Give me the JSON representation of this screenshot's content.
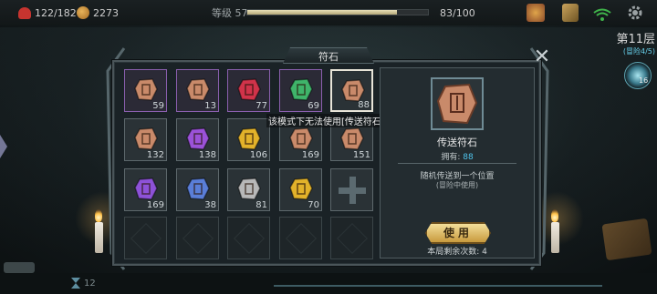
{
  "hud": {
    "hp": "122/182",
    "gold": "2273",
    "level_label": "等级 57",
    "xp_text": "83/100",
    "xp_fraction": 0.83,
    "icons": [
      "chest-icon",
      "map-card-icon",
      "wifi-icon",
      "gear-icon"
    ]
  },
  "floor": {
    "title": "第11层",
    "subtitle": "(冒险4/5)",
    "orb_count": "16"
  },
  "panel": {
    "title": "符石",
    "close_icon": "close-icon",
    "tooltip": "该模式下无法使用[传送符石]"
  },
  "runes": [
    {
      "name": "rune-1",
      "count": "59",
      "color": "#c98a6a",
      "rarity": "purple"
    },
    {
      "name": "rune-2",
      "count": "13",
      "color": "#c98a6a",
      "rarity": "purple"
    },
    {
      "name": "rune-3",
      "count": "77",
      "color": "#d0334a",
      "rarity": "purple"
    },
    {
      "name": "rune-4",
      "count": "69",
      "color": "#3fb46a",
      "rarity": "purple"
    },
    {
      "name": "teleport-rune",
      "count": "88",
      "color": "#c98a6a",
      "rarity": "selected"
    },
    {
      "name": "rune-6",
      "count": "132",
      "color": "#c98a6a",
      "rarity": "normal"
    },
    {
      "name": "rune-7",
      "count": "138",
      "color": "#9b52d8",
      "rarity": "normal"
    },
    {
      "name": "rune-8",
      "count": "106",
      "color": "#e2b22a",
      "rarity": "normal"
    },
    {
      "name": "rune-9",
      "count": "169",
      "color": "#c98a6a",
      "rarity": "normal"
    },
    {
      "name": "rune-10",
      "count": "151",
      "color": "#c98a6a",
      "rarity": "normal"
    },
    {
      "name": "rune-11",
      "count": "169",
      "color": "#8d52d8",
      "rarity": "normal"
    },
    {
      "name": "rune-12",
      "count": "38",
      "color": "#5a7ed8",
      "rarity": "normal"
    },
    {
      "name": "rune-13",
      "count": "81",
      "color": "#b8b8b8",
      "rarity": "normal"
    },
    {
      "name": "rune-14",
      "count": "70",
      "color": "#e2b22a",
      "rarity": "normal"
    }
  ],
  "detail": {
    "name": "传送符石",
    "own_label": "拥有:",
    "own_count": "88",
    "desc1": "随机传送到一个位置",
    "desc2": "(冒险中使用)",
    "use_label": "使用",
    "remaining": "本局剩余次数: 4"
  },
  "bottom": {
    "count": "12"
  }
}
